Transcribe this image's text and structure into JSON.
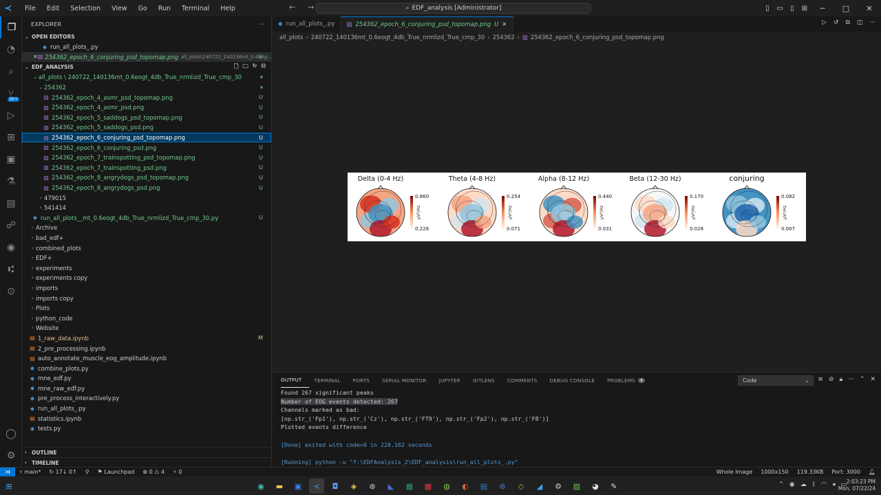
{
  "titlebar": {
    "menu": [
      "File",
      "Edit",
      "Selection",
      "View",
      "Go",
      "Run",
      "Terminal",
      "Help"
    ],
    "search": "EDF_analysis [Administrator]"
  },
  "sidebar": {
    "title": "EXPLORER",
    "open_editors_label": "OPEN EDITORS",
    "open_editors": [
      {
        "name": "run_all_plots_.py",
        "path": ""
      },
      {
        "name": "254362_epoch_6_conjuring_psd_topomap.png",
        "path": "all_plots\\240722_140136mt_0.6eog...",
        "status": "U"
      }
    ],
    "workspace_label": "EDF_ANALYSIS",
    "tree": [
      {
        "name": "all_plots \\ 240722_140136mt_0.6eogt_4db_True_nrmlizd_True_cmp_30",
        "indent": 0,
        "type": "folder-open"
      },
      {
        "name": "254362",
        "indent": 1,
        "type": "folder-open"
      },
      {
        "name": "254362_epoch_4_asmr_psd_topomap.png",
        "indent": 2,
        "type": "png",
        "status": "U"
      },
      {
        "name": "254362_epoch_4_asmr_psd.png",
        "indent": 2,
        "type": "png",
        "status": "U"
      },
      {
        "name": "254362_epoch_5_saddogs_psd_topomap.png",
        "indent": 2,
        "type": "png",
        "status": "U"
      },
      {
        "name": "254362_epoch_5_saddogs_psd.png",
        "indent": 2,
        "type": "png",
        "status": "U"
      },
      {
        "name": "254362_epoch_6_conjuring_psd_topomap.png",
        "indent": 2,
        "type": "png",
        "status": "U",
        "selected": true
      },
      {
        "name": "254362_epoch_6_conjuring_psd.png",
        "indent": 2,
        "type": "png",
        "status": "U"
      },
      {
        "name": "254362_epoch_7_trainspotting_psd_topomap.png",
        "indent": 2,
        "type": "png",
        "status": "U"
      },
      {
        "name": "254362_epoch_7_trainspotting_psd.png",
        "indent": 2,
        "type": "png",
        "status": "U"
      },
      {
        "name": "254362_epoch_8_angrydogs_psd_topomap.png",
        "indent": 2,
        "type": "png",
        "status": "U"
      },
      {
        "name": "254362_epoch_8_angrydogs_psd.png",
        "indent": 2,
        "type": "png",
        "status": "U"
      },
      {
        "name": "479015",
        "indent": 1,
        "type": "folder"
      },
      {
        "name": "541414",
        "indent": 1,
        "type": "folder"
      },
      {
        "name": "run_all_plots__mt_0.6eogt_4db_True_nrmlizd_True_cmp_30.py",
        "indent": 0,
        "type": "py",
        "status": "U"
      },
      {
        "name": "Archive",
        "indent": -1,
        "type": "folder"
      },
      {
        "name": "bad_edf+",
        "indent": -1,
        "type": "folder"
      },
      {
        "name": "combined_plots",
        "indent": -1,
        "type": "folder"
      },
      {
        "name": "EDF+",
        "indent": -1,
        "type": "folder"
      },
      {
        "name": "experiments",
        "indent": -1,
        "type": "folder"
      },
      {
        "name": "experiments copy",
        "indent": -1,
        "type": "folder"
      },
      {
        "name": "imports",
        "indent": -1,
        "type": "folder"
      },
      {
        "name": "imports copy",
        "indent": -1,
        "type": "folder"
      },
      {
        "name": "Plots",
        "indent": -1,
        "type": "folder"
      },
      {
        "name": "python_code",
        "indent": -1,
        "type": "folder"
      },
      {
        "name": "Website",
        "indent": -1,
        "type": "folder"
      },
      {
        "name": "1_raw_data.ipynb",
        "indent": -1,
        "type": "ipynb",
        "status": "M"
      },
      {
        "name": "2_pre_processing.ipynb",
        "indent": -1,
        "type": "ipynb"
      },
      {
        "name": "auto_annotate_muscle_eog_amplitude.ipynb",
        "indent": -1,
        "type": "ipynb"
      },
      {
        "name": "combine_plots.py",
        "indent": -1,
        "type": "py"
      },
      {
        "name": "mne_edf.py",
        "indent": -1,
        "type": "py"
      },
      {
        "name": "mne_raw_edf.py",
        "indent": -1,
        "type": "py"
      },
      {
        "name": "pre_process_interactively.py",
        "indent": -1,
        "type": "py"
      },
      {
        "name": "run_all_plots_.py",
        "indent": -1,
        "type": "py"
      },
      {
        "name": "statistics.ipynb",
        "indent": -1,
        "type": "ipynb"
      },
      {
        "name": "tests.py",
        "indent": -1,
        "type": "py"
      }
    ],
    "outline_label": "OUTLINE",
    "timeline_label": "TIMELINE"
  },
  "editor": {
    "tabs": [
      {
        "label": "run_all_plots_.py",
        "active": false
      },
      {
        "label": "254362_epoch_6_conjuring_psd_topomap.png",
        "active": true,
        "status": "U"
      }
    ],
    "breadcrumb": [
      "all_plots",
      "240722_140136mt_0.6eogt_4db_True_nrmlizd_True_cmp_30",
      "254362",
      "254362_epoch_6_conjuring_psd_topomap.png"
    ],
    "image": {
      "panels": [
        {
          "title": "Delta (0-4 Hz)",
          "max": "0.860",
          "min": "0.228",
          "unit": "μV²/Hz"
        },
        {
          "title": "Theta (4-8 Hz)",
          "max": "0.254",
          "min": "0.071",
          "unit": "μV²/Hz"
        },
        {
          "title": "Alpha (8-12 Hz)",
          "max": "0.440",
          "min": "0.031",
          "unit": "μV²/Hz"
        },
        {
          "title": "Beta (12-30 Hz)",
          "max": "0.170",
          "min": "0.028",
          "unit": "μV²/Hz"
        },
        {
          "title": "conjuring",
          "max": "0.082",
          "min": "0.007",
          "unit": "μV²/Hz"
        }
      ]
    }
  },
  "panel": {
    "tabs": [
      "OUTPUT",
      "TERMINAL",
      "PORTS",
      "SERIAL MONITOR",
      "JUPYTER",
      "GITLENS",
      "COMMENTS",
      "DEBUG CONSOLE",
      "PROBLEMS"
    ],
    "problems_count": "4",
    "channel": "Code",
    "output_lines": [
      "Found 267 significant peaks",
      "Number of EOG events detected: 267",
      "Channels marked as bad:",
      "[np.str_('Fp1'), np.str_('Cz'), np.str_('FT9'), np.str_('Fp2'), np.str_('F8')]",
      "Plotted events difference",
      "",
      "[Done] exited with code=0 in 228.162 seconds",
      "",
      "[Running] python -u \"f:\\EDFAnalysis_2\\EDF_analysis\\run_all_plots_.py\""
    ]
  },
  "statusbar": {
    "branch": "main*",
    "sync": "17↓ 0↑",
    "launchpad": "Launchpad",
    "errors": "0",
    "warnings": "4",
    "ports": "0",
    "right": [
      "Whole Image",
      "1000x150",
      "119.33KB",
      "Port: 3000"
    ]
  },
  "taskbar": {
    "time": "2:03:23 PM",
    "date": "Mon, 07/22/24"
  }
}
